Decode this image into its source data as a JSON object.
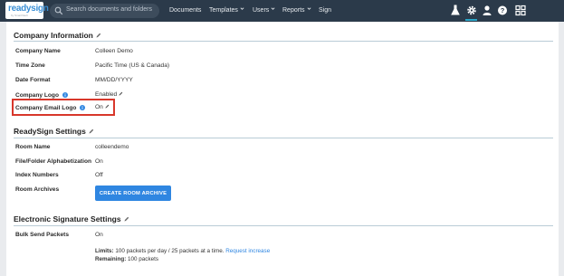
{
  "app": {
    "logo_text": "readysign",
    "logo_sub": "by SmartVault"
  },
  "search": {
    "placeholder": "Search documents and folders",
    "icon": "search-icon"
  },
  "nav": {
    "documents": "Documents",
    "templates": "Templates",
    "users": "Users",
    "reports": "Reports",
    "sign": "Sign"
  },
  "toolbar_icons": [
    "flask-icon",
    "gear-icon",
    "user-icon",
    "help-icon",
    "apps-grid-icon"
  ],
  "colors": {
    "topbar": "#2b3a4a",
    "accent": "#2aa7c9",
    "button": "#2f86e1",
    "highlight": "#d8372b"
  },
  "company_information": {
    "title": "Company Information",
    "rows": [
      {
        "label": "Company Name",
        "value": "Colleen Demo"
      },
      {
        "label": "Time Zone",
        "value": "Pacific Time (US & Canada)"
      },
      {
        "label": "Date Format",
        "value": "MM/DD/YYYY"
      },
      {
        "label": "Company Logo",
        "value": "Enabled"
      },
      {
        "label": "Company Email Logo",
        "value": "On"
      }
    ]
  },
  "readysign_settings": {
    "title": "ReadySign Settings",
    "rows": [
      {
        "label": "Room Name",
        "value": "colleendemo"
      },
      {
        "label": "File/Folder Alphabetization",
        "value": "On"
      },
      {
        "label": "Index Numbers",
        "value": "Off"
      },
      {
        "label": "Room Archives",
        "value": ""
      }
    ],
    "archive_button": "CREATE ROOM ARCHIVE"
  },
  "esign_settings": {
    "title": "Electronic Signature Settings",
    "bulk_label": "Bulk Send Packets",
    "bulk_value": "On",
    "limits_label": "Limits:",
    "limits_text": "100 packets per day / 25 packets at a time.",
    "limits_link": "Request increase",
    "remaining_label": "Remaining:",
    "remaining_text": "100 packets"
  }
}
